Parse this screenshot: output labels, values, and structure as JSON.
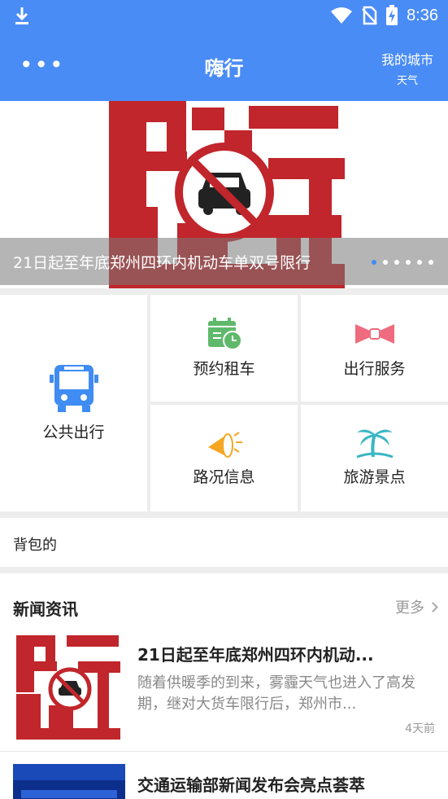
{
  "status_bar": {
    "time": "8:36"
  },
  "app_bar": {
    "title": "嗨行",
    "city": "我的城市",
    "weather": "天气"
  },
  "banner": {
    "caption": "21日起至年底郑州四环内机动车单双号限行",
    "image_text": "限行通知",
    "slide_count": 6,
    "active_slide": 1
  },
  "services": {
    "public": "公共出行",
    "rent": "预约租车",
    "travel_service": "出行服务",
    "traffic": "路况信息",
    "tourism": "旅游景点"
  },
  "bag": {
    "label": "背包的"
  },
  "news": {
    "title": "新闻资讯",
    "more": "更多",
    "items": [
      {
        "title": "21日起至年底郑州四环内机动...",
        "desc": "随着供暖季的到来，雾霾天气也进入了高发期，继对大货车限行后，郑州市...",
        "time": "4天前",
        "thumb_text": "限行通知"
      },
      {
        "title": "交通运输部新闻发布会亮点荟萃"
      }
    ]
  },
  "colors": {
    "primary": "#4a8cf5",
    "banner_red": "#c0262b",
    "icon_green": "#5fb96b",
    "icon_pink": "#ef6b7f",
    "icon_orange": "#f5a623",
    "icon_teal": "#39b7c4",
    "icon_blue": "#3f8cf2"
  },
  "icons": {
    "download": "download-icon",
    "wifi": "wifi-icon",
    "no_sim": "no-sim-icon",
    "battery": "battery-charging-icon",
    "menu": "more-icon",
    "bus": "bus-icon",
    "calendar": "calendar-clock-icon",
    "bow": "bow-tie-icon",
    "megaphone": "megaphone-icon",
    "palm": "palm-tree-icon"
  }
}
